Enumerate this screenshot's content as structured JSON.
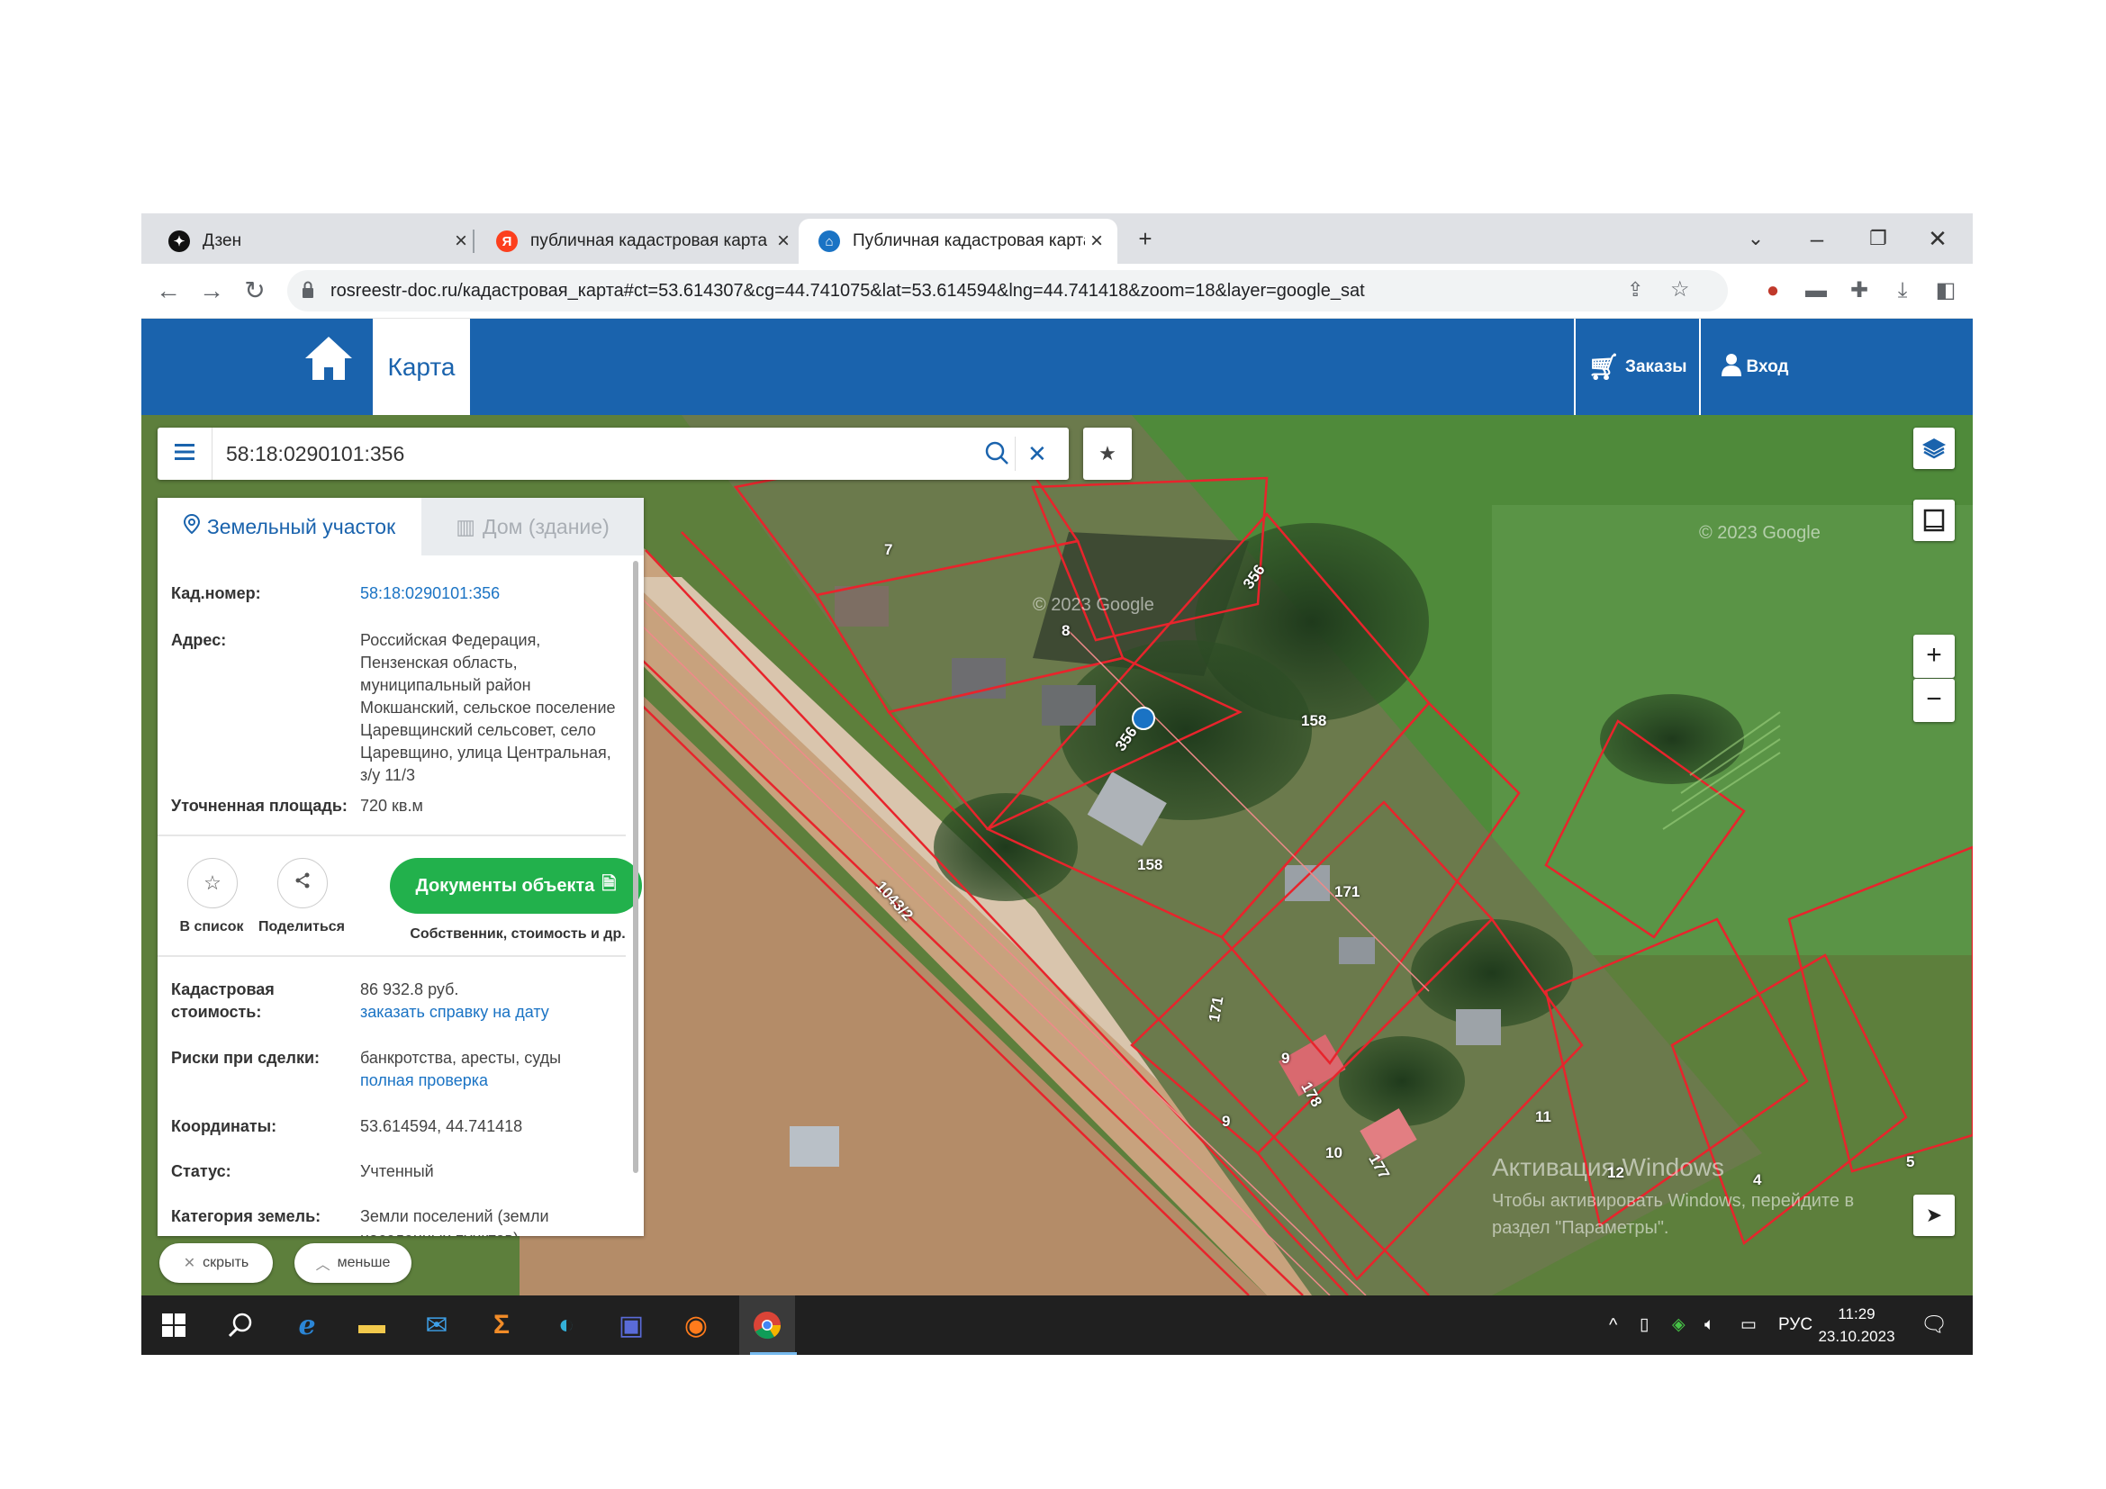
{
  "browser": {
    "tabs": [
      {
        "label": "Дзен",
        "icon": "zen-icon"
      },
      {
        "label": "публичная кадастровая карта -",
        "icon": "yandex-icon"
      },
      {
        "label": "Публичная кадастровая карта",
        "icon": "rosreestr-icon"
      }
    ],
    "url": "rosreestr-doc.ru/кадастровая_карта#ct=53.614307&cg=44.741075&lat=53.614594&lng=44.741418&zoom=18&layer=google_sat"
  },
  "site": {
    "nav_map": "Карта",
    "orders": "Заказы",
    "login": "Вход",
    "brand_color": "#1a63ad"
  },
  "search": {
    "value": "58:18:0290101:356"
  },
  "panel": {
    "tab_land": "Земельный участок",
    "tab_house": "Дом (здание)",
    "cad_label": "Кад.номер:",
    "cad_value": "58:18:0290101:356",
    "addr_label": "Адрес:",
    "addr_value": "Российская Федерация, Пензенская область, муниципальный район Мокшанский, сельское поселение Царевщинский сельсовет, село Царевщино, улица Центральная, з/у 11/3",
    "area_label": "Уточненная площадь:",
    "area_value": "720 кв.м",
    "to_list": "В список",
    "share": "Поделиться",
    "docs_button": "Документы объекта",
    "docs_sub": "Собственник, стоимость и др.",
    "cost_label": "Кадастровая стоимость:",
    "cost_value": "86 932.8 руб.",
    "cost_link": "заказать справку на дату",
    "risk_label": "Риски при сделки:",
    "risk_value": "банкротства, аресты, суды",
    "risk_link": "полная проверка",
    "coords_label": "Координаты:",
    "coords_value": "53.614594, 44.741418",
    "status_label": "Статус:",
    "status_value": "Учтенный",
    "category_label": "Категория земель:",
    "category_value": "Земли поселений (земли населенных пунктов)",
    "hide": "скрыть",
    "less": "меньше"
  },
  "map": {
    "plot_labels": [
      "7",
      "8",
      "356",
      "356",
      "158",
      "158",
      "171",
      "171",
      "1043/2",
      "9",
      "9",
      "178",
      "10",
      "177",
      "11",
      "12",
      "4",
      "5"
    ],
    "watermark_google": "© 2023 Google",
    "activation_title": "Активация Windows",
    "activation_text": "Чтобы активировать Windows, перейдите в раздел \"Параметры\"."
  },
  "taskbar": {
    "lang": "РУС",
    "time": "11:29",
    "date": "23.10.2023"
  }
}
